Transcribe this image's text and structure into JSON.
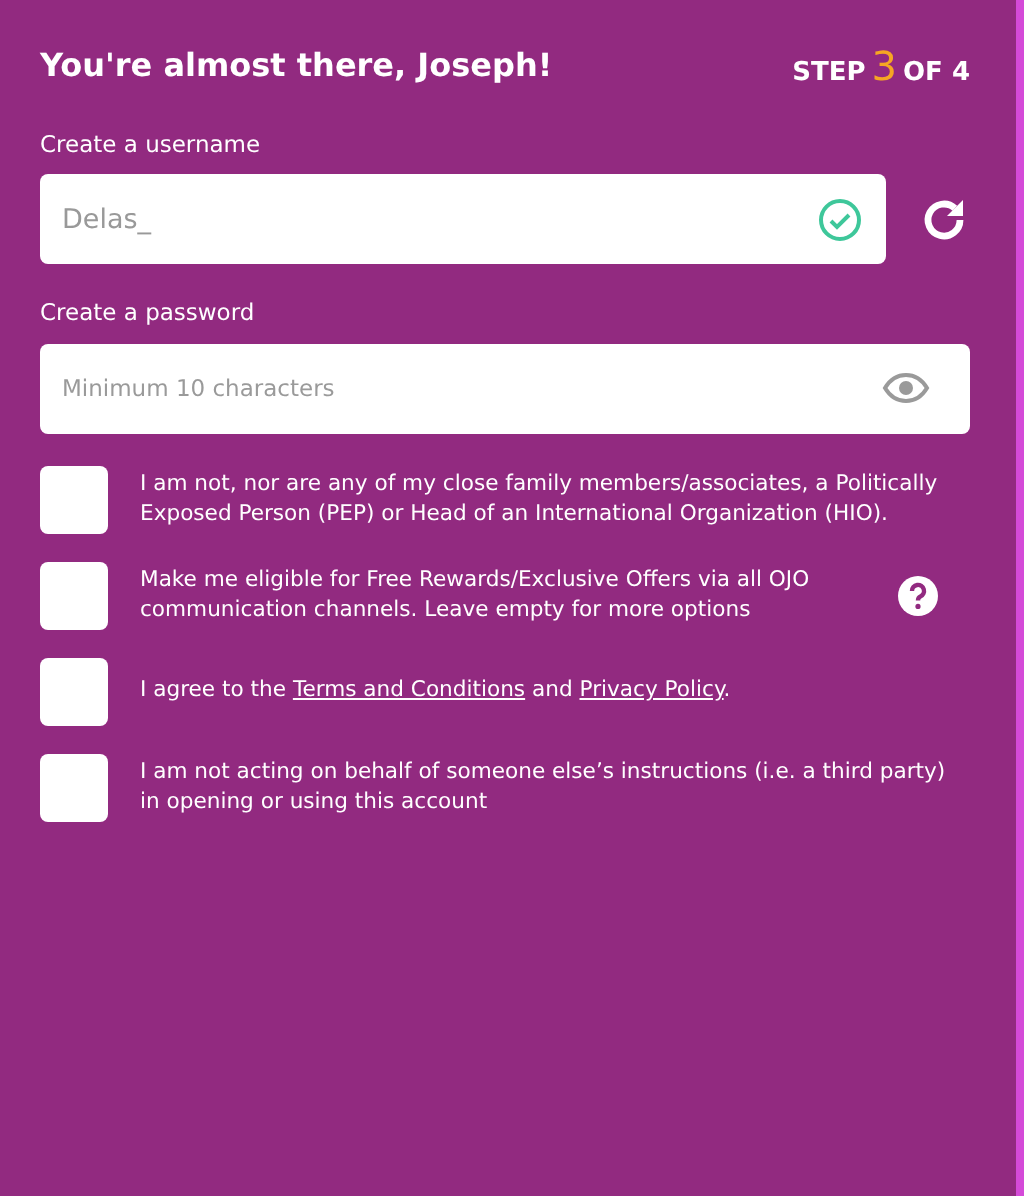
{
  "header": {
    "title": "You're almost there, Joseph!",
    "step": {
      "prefix": "STEP",
      "current": "3",
      "suffix": "OF 4"
    }
  },
  "username": {
    "label": "Create a username",
    "value": "Delas_",
    "valid": true
  },
  "password": {
    "label": "Create a password",
    "placeholder": "Minimum 10 characters"
  },
  "agreements": [
    {
      "checked": false,
      "help": false,
      "parts": [
        {
          "kind": "text",
          "text": "I am not, nor are any of my close family members/associates, a Politically Exposed Person (PEP) or Head of an International Organization (HIO)."
        }
      ]
    },
    {
      "checked": false,
      "help": true,
      "parts": [
        {
          "kind": "text",
          "text": "Make me eligible for Free Rewards/Exclusive Offers via all OJO communication channels. Leave empty for more options"
        }
      ]
    },
    {
      "checked": false,
      "help": false,
      "parts": [
        {
          "kind": "text",
          "text": "I agree to the "
        },
        {
          "kind": "link",
          "text": "Terms and Conditions"
        },
        {
          "kind": "text",
          "text": " and "
        },
        {
          "kind": "link",
          "text": "Privacy Policy"
        },
        {
          "kind": "text",
          "text": "."
        }
      ]
    },
    {
      "checked": false,
      "help": false,
      "parts": [
        {
          "kind": "text",
          "text": "I am not acting on behalf of someone else’s instructions (i.e. a third party) in opening or using this account"
        }
      ]
    }
  ]
}
